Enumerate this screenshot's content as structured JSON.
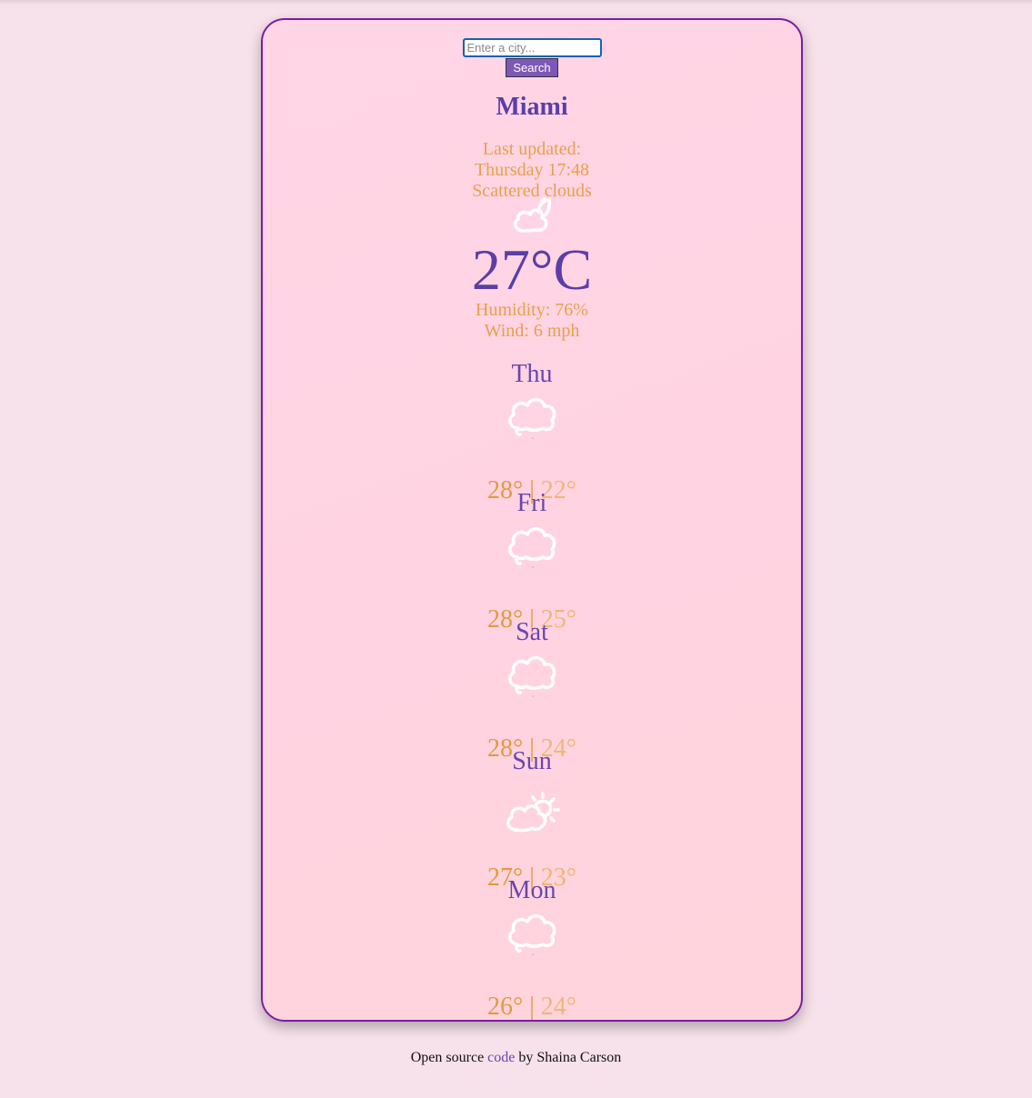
{
  "search": {
    "placeholder": "Enter a city...",
    "value": "",
    "button_label": "Search"
  },
  "current": {
    "city": "Miami",
    "last_updated_label": "Last updated:",
    "last_updated_value": "Thursday 17:48",
    "description": "Scattered clouds",
    "icon": "scattered-clouds-icon",
    "temperature": "27°C",
    "humidity": "Humidity: 76%",
    "wind": "Wind: 6 mph"
  },
  "forecast": [
    {
      "day": "Thu",
      "icon": "cloud-icon",
      "max": "28°",
      "sep": "|",
      "min": "22°"
    },
    {
      "day": "Fri",
      "icon": "cloud-icon",
      "max": "28°",
      "sep": "|",
      "min": "25°"
    },
    {
      "day": "Sat",
      "icon": "cloud-icon",
      "max": "28°",
      "sep": "|",
      "min": "24°"
    },
    {
      "day": "Sun",
      "icon": "partly-sunny-icon",
      "max": "27°",
      "sep": "|",
      "min": "23°"
    },
    {
      "day": "Mon",
      "icon": "cloud-icon",
      "max": "26°",
      "sep": "|",
      "min": "24°"
    }
  ],
  "footer": {
    "prefix": "Open source",
    "link": "code",
    "suffix": "by Shaina Carson"
  },
  "colors": {
    "accent": "#5b3ea6",
    "secondary": "#e8a04a",
    "border": "#7a1ea1",
    "background": "#f7e1ea"
  }
}
